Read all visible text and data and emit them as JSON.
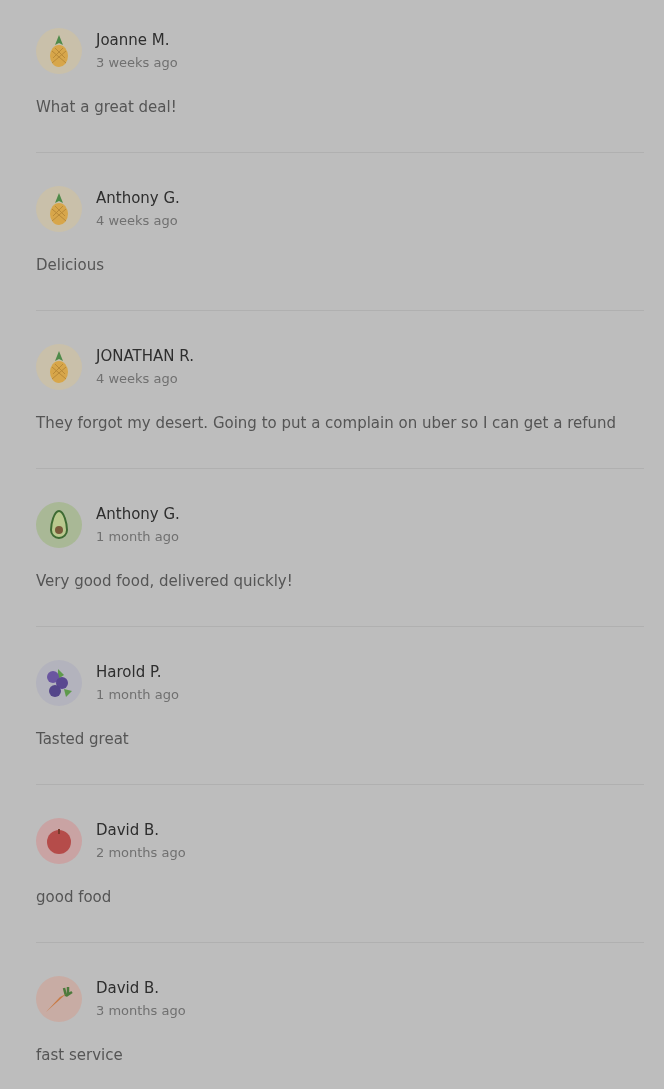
{
  "reviews": [
    {
      "name": "Joanne M.",
      "time": "3 weeks ago",
      "text": "What a great deal!",
      "kind": "pineapple"
    },
    {
      "name": "Anthony G.",
      "time": "4 weeks ago",
      "text": "Delicious",
      "kind": "pineapple"
    },
    {
      "name": "JONATHAN R.",
      "time": "4 weeks ago",
      "text": "They forgot my desert. Going to put a complain on uber so I can get a refund",
      "kind": "pineapple"
    },
    {
      "name": "Anthony G.",
      "time": "1 month ago",
      "text": "Very good food, delivered quickly!",
      "kind": "avocado"
    },
    {
      "name": "Harold P.",
      "time": "1 month ago",
      "text": "Tasted great",
      "kind": "blueberry"
    },
    {
      "name": "David B.",
      "time": "2 months ago",
      "text": "good food",
      "kind": "tomato"
    },
    {
      "name": "David B.",
      "time": "3 months ago",
      "text": "fast service",
      "kind": "carrot"
    }
  ]
}
